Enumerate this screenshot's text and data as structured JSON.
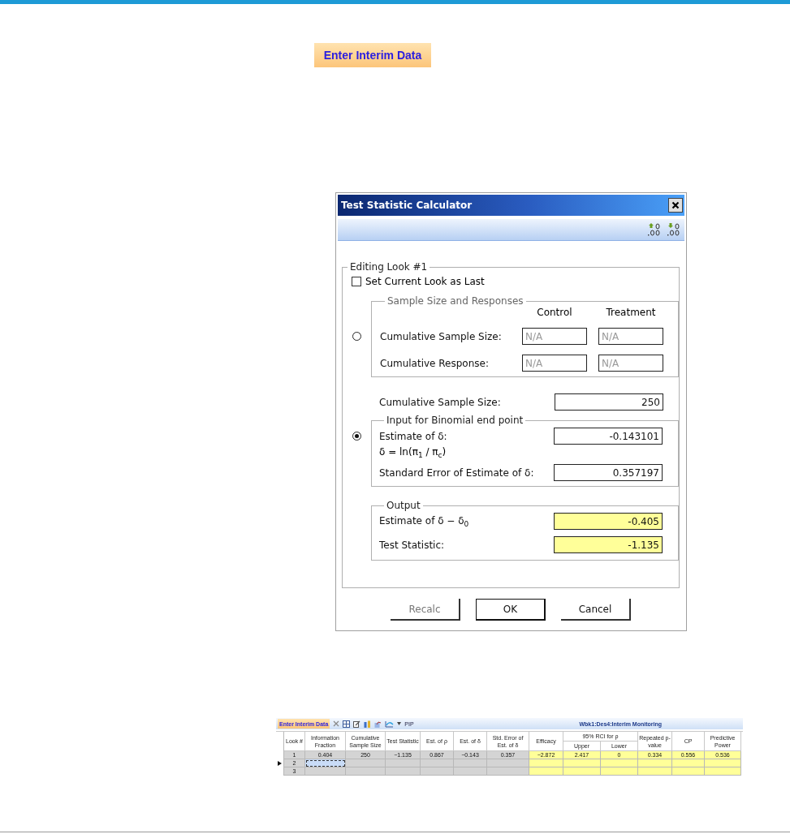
{
  "page_button": "Enter Interim Data",
  "dialog": {
    "title": "Test Statistic Calculator",
    "group_title": "Editing Look #1",
    "set_last": {
      "label": "Set Current Look as Last",
      "checked": false
    },
    "options": [
      {
        "kind": "grid",
        "selected": false,
        "panel": {
          "title": "Sample Size and Responses",
          "columns": [
            "Control",
            "Treatment"
          ],
          "rows": [
            {
              "label": "Cumulative Sample Size:",
              "values": [
                "N/A",
                "N/A"
              ]
            },
            {
              "label": "Cumulative Response:",
              "values": [
                "N/A",
                "N/A"
              ]
            }
          ]
        }
      },
      {
        "kind": "binomial",
        "selected": true,
        "sample_size": {
          "label": "Cumulative Sample Size:",
          "value": "250"
        },
        "panel": {
          "title": "Input for Binomial end point",
          "rows": [
            {
              "kind": "field",
              "label": "Estimate of δ:",
              "value": "-0.143101"
            },
            {
              "kind": "note",
              "label": "δ = ln(π$_{1}$ / π$_{c}$)"
            },
            {
              "kind": "field",
              "label": "Standard Error of Estimate of δ:",
              "value": "0.357197"
            }
          ]
        }
      }
    ],
    "output": {
      "title": "Output",
      "rows": [
        {
          "label": "Estimate of δ − δ$_{0}$",
          "value": "-0.405"
        },
        {
          "label": "Test Statistic:",
          "value": "-1.135"
        }
      ]
    },
    "buttons": [
      {
        "label": "Recalc",
        "disabled": true,
        "default": false
      },
      {
        "label": "OK",
        "disabled": false,
        "default": true
      },
      {
        "label": "Cancel",
        "disabled": false,
        "default": false
      }
    ]
  },
  "table": {
    "toolbar_button": "Enter Interim Data",
    "toolbar_text": "PIP",
    "title": "Wbk1:Des4:Interim Monitoring",
    "columns": [
      {
        "label": "Look #",
        "kind": "input"
      },
      {
        "label": "Information Fraction",
        "kind": "input"
      },
      {
        "label": "Cumulative Sample Size",
        "kind": "input"
      },
      {
        "label": "Test Statistic",
        "kind": "input"
      },
      {
        "label": "Est. of ρ",
        "kind": "input"
      },
      {
        "label": "Est. of δ",
        "kind": "input"
      },
      {
        "label": "Std. Error of Est. of δ",
        "kind": "input"
      },
      {
        "label": "Efficacy",
        "kind": "output"
      },
      {
        "label": "Upper",
        "kind": "output",
        "group": "95% RCI for ρ"
      },
      {
        "label": "Lower",
        "kind": "output",
        "grouped": true
      },
      {
        "label": "Repeated p-value",
        "kind": "output"
      },
      {
        "label": "CP",
        "kind": "output"
      },
      {
        "label": "Predictive Power",
        "kind": "output"
      }
    ],
    "rows": [
      {
        "selected": false,
        "cells": [
          "1",
          "0.404",
          "250",
          "−1.135",
          "0.867",
          "−0.143",
          "0.357",
          "−2.872",
          "2.417",
          "0",
          "0.334",
          "0.556",
          "0.536"
        ]
      },
      {
        "selected": true,
        "cells": [
          "2"
        ]
      },
      {
        "selected": false,
        "cells": [
          "3"
        ]
      }
    ]
  }
}
